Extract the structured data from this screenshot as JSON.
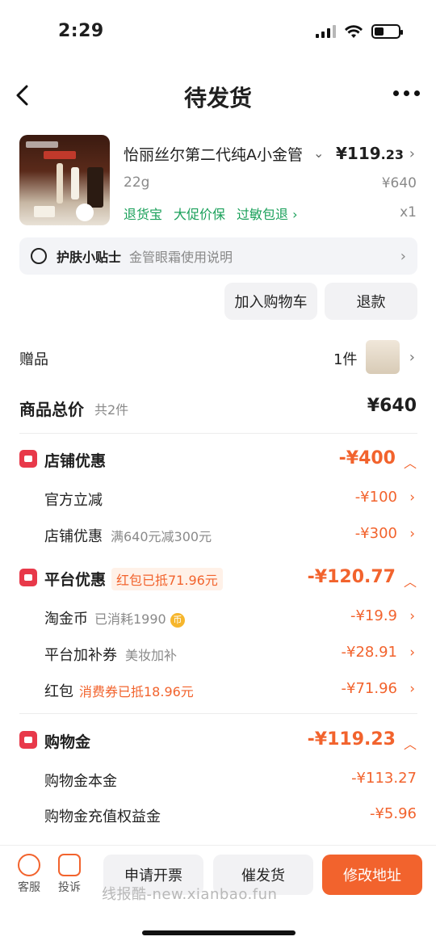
{
  "status": {
    "time": "2:29"
  },
  "nav": {
    "title": "待发货"
  },
  "product": {
    "name": "怡丽丝尔第二代纯A小金管",
    "price_int": "¥119",
    "price_dec": ".23",
    "spec": "22g",
    "original_price": "¥640",
    "quantity": "x1",
    "tags": [
      "退货宝",
      "大促价保",
      "过敏包退 ›"
    ]
  },
  "tip": {
    "title": "护肤小贴士",
    "desc": "金管眼霜使用说明"
  },
  "actions": {
    "add_cart": "加入购物车",
    "refund": "退款"
  },
  "gift": {
    "label": "赠品",
    "count": "1件"
  },
  "total": {
    "label": "商品总价",
    "count": "共2件",
    "value": "¥640"
  },
  "store_discount": {
    "title": "店铺优惠",
    "amount": "-¥400",
    "rows": [
      {
        "label": "官方立减",
        "sub": "",
        "amount": "-¥100"
      },
      {
        "label": "店铺优惠",
        "sub": "满640元减300元",
        "amount": "-¥300"
      }
    ]
  },
  "platform_discount": {
    "title": "平台优惠",
    "badge": "红包已抵71.96元",
    "amount": "-¥120.77",
    "rows": [
      {
        "label": "淘金币",
        "sub": "已消耗1990",
        "amount": "-¥19.9"
      },
      {
        "label": "平台加补券",
        "sub": "美妆加补",
        "amount": "-¥28.91"
      },
      {
        "label": "红包",
        "sub": "消费券已抵18.96元",
        "amount": "-¥71.96"
      }
    ]
  },
  "shopping_gold": {
    "title": "购物金",
    "amount": "-¥119.23",
    "rows": [
      {
        "label": "购物金本金",
        "amount": "-¥113.27"
      },
      {
        "label": "购物金充值权益金",
        "amount": "-¥5.96"
      }
    ]
  },
  "bottom": {
    "service": "客服",
    "complaint": "投诉",
    "invoice": "申请开票",
    "urge": "催发货",
    "change_address": "修改地址",
    "watermark": "线报酷-new.xianbao.fun"
  },
  "colors": {
    "accent": "#f2632d",
    "green": "#1aa05a",
    "red_icon": "#e8394a"
  }
}
